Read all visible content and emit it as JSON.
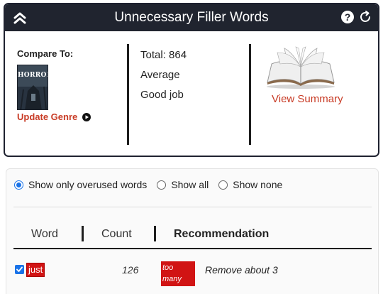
{
  "header": {
    "title": "Unnecessary Filler Words",
    "collapse_icon": "double-chevron-up-icon",
    "help_icon": "question-circle-icon",
    "refresh_icon": "refresh-icon"
  },
  "compare": {
    "label": "Compare To:",
    "genre_cover_title": "HORROR",
    "update_genre_label": "Update Genre"
  },
  "stats": {
    "total": "Total: 864",
    "rating": "Average",
    "feedback": "Good job"
  },
  "summary": {
    "view_summary_label": "View Summary"
  },
  "filters": {
    "options": [
      {
        "label": "Show only overused words",
        "selected": true
      },
      {
        "label": "Show all",
        "selected": false
      },
      {
        "label": "Show none",
        "selected": false
      }
    ]
  },
  "table": {
    "columns": [
      "Word",
      "Count",
      "Recommendation"
    ],
    "rows": [
      {
        "checked": true,
        "word": "just",
        "count": "126",
        "tag": "too many",
        "recommendation": "Remove about 3"
      }
    ]
  },
  "colors": {
    "header_bg": "#20242f",
    "accent_red": "#c83b25",
    "chip_red": "#d11414",
    "radio_blue": "#1a73e8"
  }
}
